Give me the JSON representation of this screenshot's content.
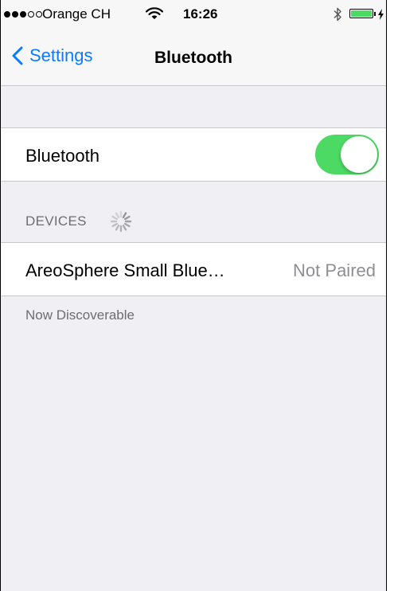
{
  "status_bar": {
    "signal_dots": [
      true,
      true,
      true,
      false,
      false
    ],
    "carrier": "Orange CH",
    "wifi_icon": "wifi-icon",
    "time": "16:26",
    "bluetooth_icon": "bluetooth-icon",
    "battery_level": 1.0,
    "battery_color": "#4cd964",
    "charging_icon": "charging-bolt-icon"
  },
  "nav": {
    "back_label": "Settings",
    "title": "Bluetooth",
    "accent_color": "#0a7bff"
  },
  "bluetooth_row": {
    "label": "Bluetooth",
    "toggle_on": true,
    "toggle_color": "#4cd964"
  },
  "devices_section": {
    "header": "DEVICES",
    "loading_icon": "activity-spinner-icon",
    "items": [
      {
        "name": "AreoSphere Small Blue…",
        "status": "Not Paired"
      }
    ]
  },
  "footer": {
    "note": "Now Discoverable"
  }
}
